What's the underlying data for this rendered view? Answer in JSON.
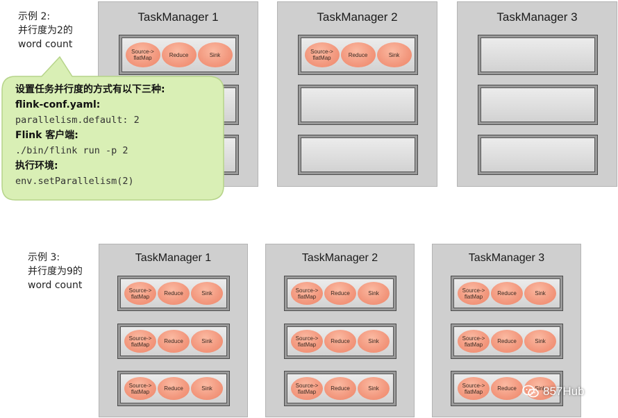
{
  "example2": {
    "label_lines": [
      "示例 2:",
      "并行度为2的",
      "word count"
    ],
    "task_managers": [
      {
        "title": "TaskManager 1",
        "slots": [
          [
            "Source->\nflatMap",
            "Reduce",
            "Sink"
          ],
          [],
          []
        ]
      },
      {
        "title": "TaskManager 2",
        "slots": [
          [
            "Source->\nflatMap",
            "Reduce",
            "Sink"
          ],
          [],
          []
        ]
      },
      {
        "title": "TaskManager 3",
        "slots": [
          [],
          [],
          []
        ]
      }
    ]
  },
  "callout": {
    "heading": "设置任务并行度的方式有以下三种:",
    "config_label": "flink-conf.yaml:",
    "config_code": "parallelism.default: 2",
    "client_label": "Flink 客户端:",
    "client_code": "./bin/flink run -p 2",
    "env_label": "执行环境:",
    "env_code": "env.setParallelism(2)"
  },
  "example3": {
    "label_lines": [
      "示例 3:",
      "并行度为9的",
      "word count"
    ],
    "task_managers": [
      {
        "title": "TaskManager 1",
        "slots": [
          [
            "Source->\nflatMap",
            "Reduce",
            "Sink"
          ],
          [
            "Source->\nflatMap",
            "Reduce",
            "Sink"
          ],
          [
            "Source->\nflatMap",
            "Reduce",
            "Sink"
          ]
        ]
      },
      {
        "title": "TaskManager 2",
        "slots": [
          [
            "Source->\nflatMap",
            "Reduce",
            "Sink"
          ],
          [
            "Source->\nflatMap",
            "Reduce",
            "Sink"
          ],
          [
            "Source->\nflatMap",
            "Reduce",
            "Sink"
          ]
        ]
      },
      {
        "title": "TaskManager 3",
        "slots": [
          [
            "Source->\nflatMap",
            "Reduce",
            "Sink"
          ],
          [
            "Source->\nflatMap",
            "Reduce",
            "Sink"
          ],
          [
            "Source->\nflatMap",
            "Reduce",
            "Sink"
          ]
        ]
      }
    ]
  },
  "watermark": {
    "text": "857Hub",
    "icon": "wechat-icon"
  }
}
